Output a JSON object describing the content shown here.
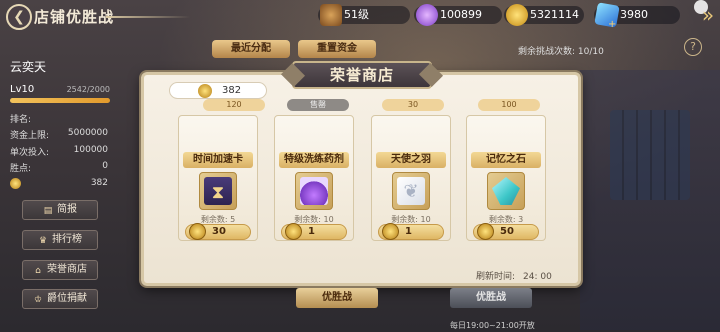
{
  "title": "店铺优胜战",
  "resources": {
    "level": "51级",
    "gems": "100899",
    "gold": "5321114",
    "diamonds": "3980"
  },
  "player": {
    "name": "云奕天",
    "level": "Lv10",
    "xp": "2542/2000",
    "xp_progress": 1.0,
    "stats": [
      {
        "label": "排名:",
        "value": ""
      },
      {
        "label": "资金上限:",
        "value": "5000000"
      },
      {
        "label": "单次投入:",
        "value": "100000"
      },
      {
        "label": "胜点:",
        "value": "0"
      }
    ],
    "coins": "382"
  },
  "side_menu": [
    {
      "label": "简报",
      "icon": "report-icon"
    },
    {
      "label": "排行榜",
      "icon": "trophy-icon"
    },
    {
      "label": "荣誉商店",
      "icon": "shop-icon"
    },
    {
      "label": "爵位捐献",
      "icon": "crown-icon"
    }
  ],
  "top_tabs": [
    "最近分配",
    "重置资金"
  ],
  "remaining_challenges": "剩余挑战次数: 10/10",
  "shop": {
    "title": "荣誉商店",
    "currency": "382",
    "peek_items": [
      {
        "text": "120"
      },
      {
        "text": "售罄"
      },
      {
        "text": "30"
      },
      {
        "text": "100"
      }
    ],
    "items": [
      {
        "name": "时间加速卡",
        "remain": "剩余数: 5",
        "price": "30",
        "icon": "hourglass-card-icon"
      },
      {
        "name": "特级洗练药剂",
        "remain": "剩余数: 10",
        "price": "1",
        "icon": "potion-icon"
      },
      {
        "name": "天使之羽",
        "remain": "剩余数: 10",
        "price": "1",
        "icon": "feather-icon"
      },
      {
        "name": "记忆之石",
        "remain": "剩余数: 3",
        "price": "50",
        "icon": "crystal-icon"
      }
    ],
    "refresh_label": "刷新时间:",
    "refresh_time": "24: 00"
  },
  "bottom": {
    "btn1": "优胜战",
    "btn2": "优胜战",
    "open_time": "每日19:00~21:00开放"
  }
}
